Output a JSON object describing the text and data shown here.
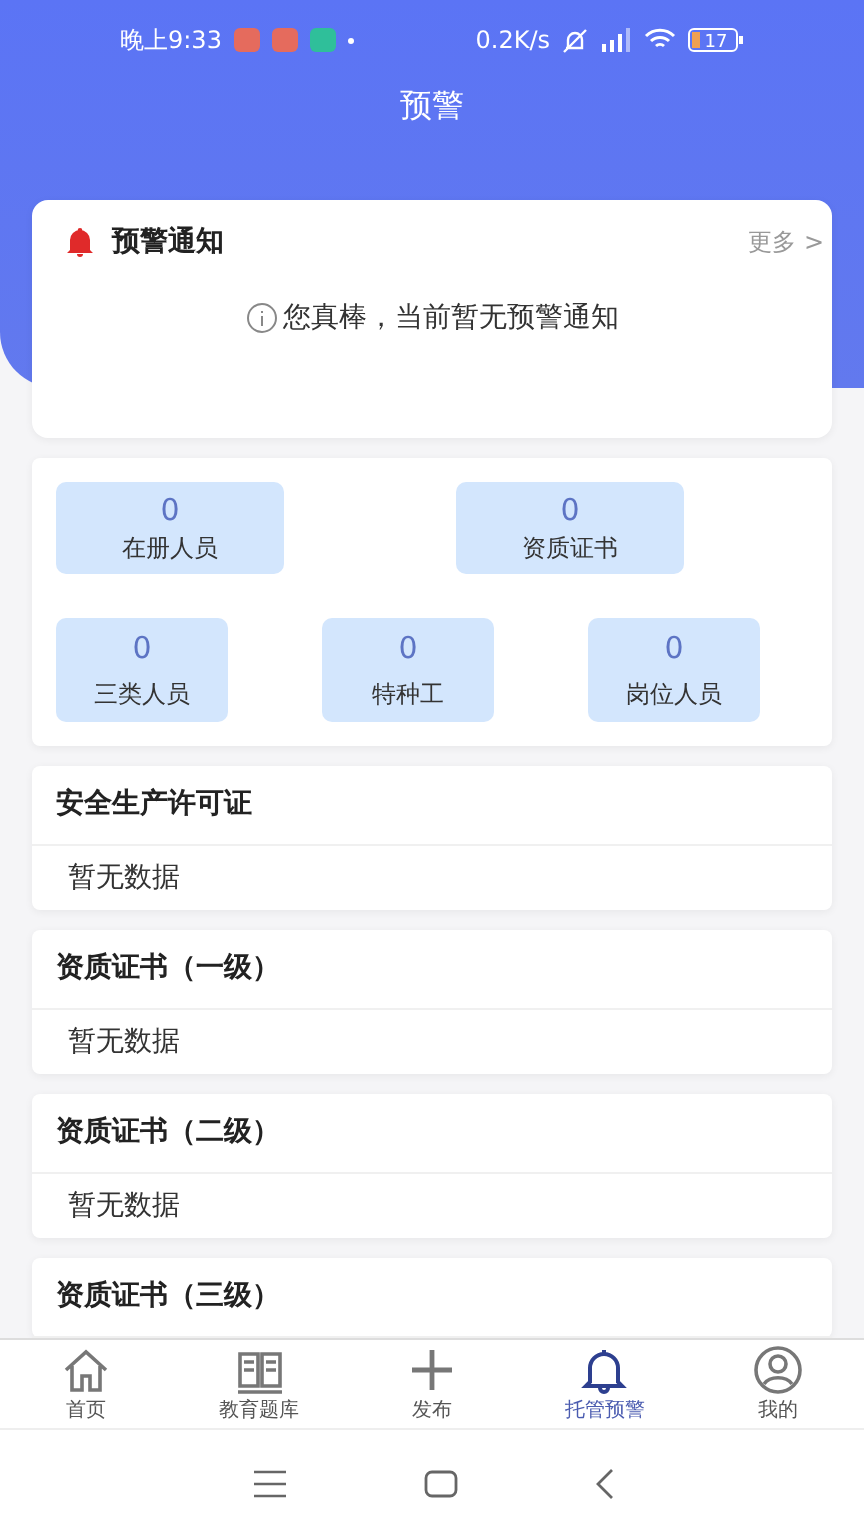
{
  "status_bar": {
    "time": "晚上9:33",
    "speed": "0.2K/s",
    "battery": "17"
  },
  "header": {
    "title": "预警"
  },
  "notice": {
    "title": "预警通知",
    "more": "更多",
    "more_icon": ">",
    "message": "您真棒，当前暂无预警通知"
  },
  "stats": [
    [
      {
        "value": "0",
        "label": "在册人员"
      },
      {
        "value": "0",
        "label": "资质证书"
      }
    ],
    [
      {
        "value": "0",
        "label": "三类人员"
      },
      {
        "value": "0",
        "label": "特种工"
      },
      {
        "value": "0",
        "label": "岗位人员"
      }
    ]
  ],
  "sections": [
    {
      "title": "安全生产许可证",
      "body": "暂无数据"
    },
    {
      "title": "资质证书（一级）",
      "body": "暂无数据"
    },
    {
      "title": "资质证书（二级）",
      "body": "暂无数据"
    },
    {
      "title": "资质证书（三级）"
    }
  ],
  "tabs": [
    {
      "kind": "home",
      "label": "首页",
      "selected": false
    },
    {
      "kind": "book",
      "label": "教育题库",
      "selected": false
    },
    {
      "kind": "plus",
      "label": "发布",
      "selected": false
    },
    {
      "kind": "bell",
      "label": "托管预警",
      "selected": true
    },
    {
      "kind": "user",
      "label": "我的",
      "selected": false
    }
  ]
}
